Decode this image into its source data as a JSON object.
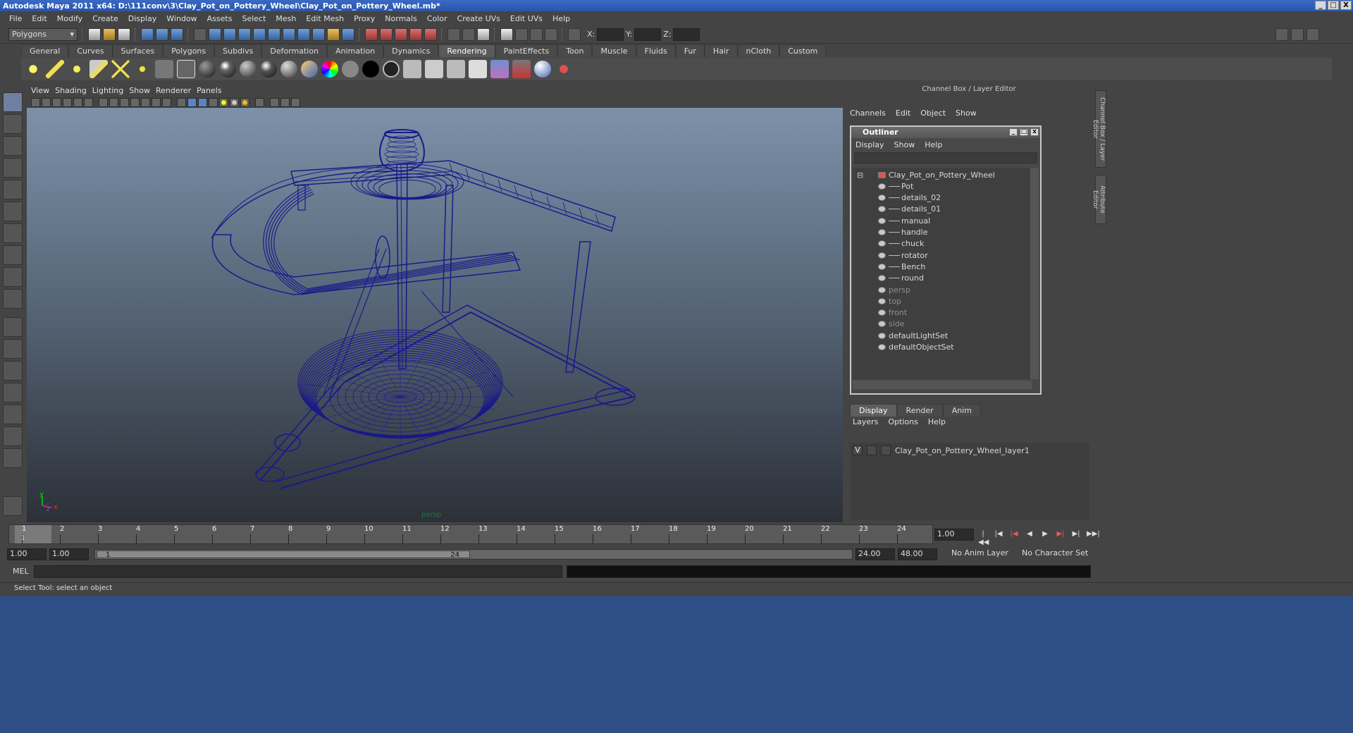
{
  "window": {
    "title": "Autodesk Maya 2011 x64: D:\\111conv\\3\\Clay_Pot_on_Pottery_Wheel\\Clay_Pot_on_Pottery_Wheel.mb*",
    "min": "_",
    "max": "□",
    "close": "X"
  },
  "menus": [
    "File",
    "Edit",
    "Modify",
    "Create",
    "Display",
    "Window",
    "Assets",
    "Select",
    "Mesh",
    "Edit Mesh",
    "Proxy",
    "Normals",
    "Color",
    "Create UVs",
    "Edit UVs",
    "Help"
  ],
  "status_line": {
    "mode": "Polygons",
    "x_label": "X:",
    "y_label": "Y:",
    "z_label": "Z:"
  },
  "shelf_tabs": [
    "General",
    "Curves",
    "Surfaces",
    "Polygons",
    "Subdivs",
    "Deformation",
    "Animation",
    "Dynamics",
    "Rendering",
    "PaintEffects",
    "Toon",
    "Muscle",
    "Fluids",
    "Fur",
    "Hair",
    "nCloth",
    "Custom"
  ],
  "active_shelf": "Rendering",
  "viewport": {
    "menus": [
      "View",
      "Shading",
      "Lighting",
      "Show",
      "Renderer",
      "Panels"
    ],
    "camera": "persp",
    "axis_y": "y",
    "axis_x": "x",
    "axis_z": "z",
    "wire_color": "#1a1a8a"
  },
  "channel_box": {
    "title": "Channel Box / Layer Editor",
    "menus": [
      "Channels",
      "Edit",
      "Object",
      "Show"
    ]
  },
  "outliner": {
    "title": "Outliner",
    "menus": [
      "Display",
      "Show",
      "Help"
    ],
    "items": [
      {
        "label": "Clay_Pot_on_Pottery_Wheel",
        "level": 0,
        "dim": false
      },
      {
        "label": "Pot",
        "level": 1,
        "dim": false
      },
      {
        "label": "details_02",
        "level": 1,
        "dim": false
      },
      {
        "label": "details_01",
        "level": 1,
        "dim": false
      },
      {
        "label": "manual",
        "level": 1,
        "dim": false
      },
      {
        "label": "handle",
        "level": 1,
        "dim": false
      },
      {
        "label": "chuck",
        "level": 1,
        "dim": false
      },
      {
        "label": "rotator",
        "level": 1,
        "dim": false
      },
      {
        "label": "Bench",
        "level": 1,
        "dim": false
      },
      {
        "label": "round",
        "level": 1,
        "dim": false
      },
      {
        "label": "persp",
        "level": 0,
        "dim": true
      },
      {
        "label": "top",
        "level": 0,
        "dim": true
      },
      {
        "label": "front",
        "level": 0,
        "dim": true
      },
      {
        "label": "side",
        "level": 0,
        "dim": true
      },
      {
        "label": "defaultLightSet",
        "level": 0,
        "dim": false
      },
      {
        "label": "defaultObjectSet",
        "level": 0,
        "dim": false
      }
    ]
  },
  "layer_editor": {
    "tabs": [
      "Display",
      "Render",
      "Anim"
    ],
    "active_tab": "Display",
    "menus": [
      "Layers",
      "Options",
      "Help"
    ],
    "layer": {
      "visible": "V",
      "name": "Clay_Pot_on_Pottery_Wheel_layer1"
    }
  },
  "side_tabs": [
    "Channel Box / Layer Editor",
    "Attribute Editor"
  ],
  "time_slider": {
    "ticks": [
      "1",
      "2",
      "3",
      "4",
      "5",
      "6",
      "7",
      "8",
      "9",
      "10",
      "11",
      "12",
      "13",
      "14",
      "15",
      "16",
      "17",
      "18",
      "19",
      "20",
      "21",
      "22",
      "23",
      "24"
    ],
    "current_frame_marker": "1",
    "current_frame": "1.00"
  },
  "range_slider": {
    "start": "1.00",
    "inner_start": "1.00",
    "thumb_start": "1",
    "thumb_end": "24",
    "end": "24.00",
    "outer_end": "48.00",
    "anim_layer": "No Anim Layer",
    "character_set": "No Character Set"
  },
  "command_line": {
    "label": "MEL"
  },
  "help_line": "Select Tool: select an object"
}
